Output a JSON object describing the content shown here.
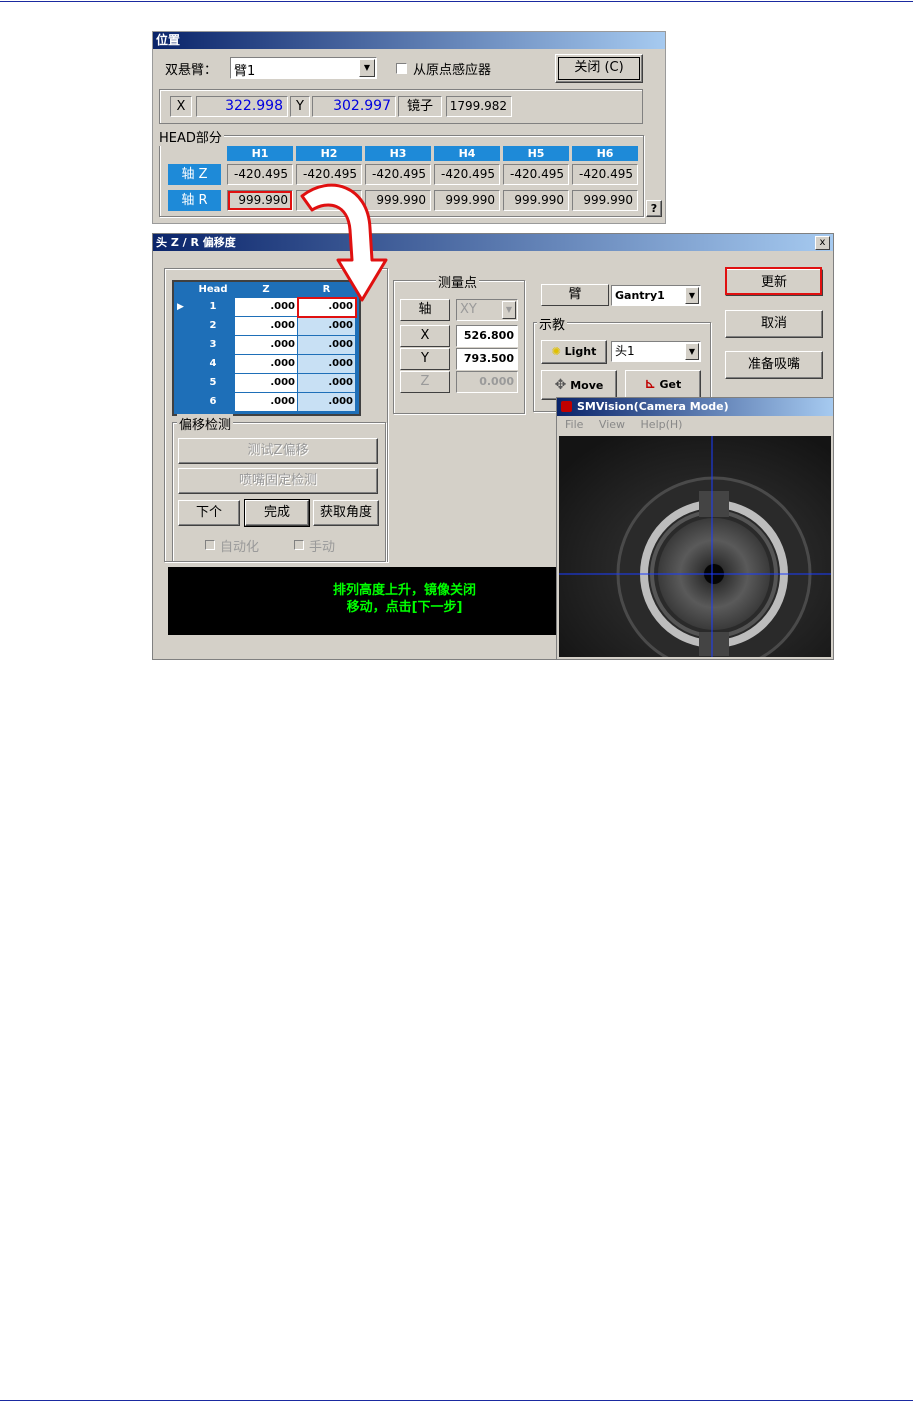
{
  "position_window": {
    "title": "位置",
    "gantry_label": "双悬臂：",
    "gantry_value": "臂1",
    "origin_sensor_label": "从原点感应器",
    "close_label": "关闭 (C)",
    "x_label": "X",
    "x_value": "322.998",
    "y_label": "Y",
    "y_value": "302.997",
    "mirror_label": "镜子",
    "mirror_value": "1799.982",
    "head_group_label": "HEAD部分",
    "heads": [
      "H1",
      "H2",
      "H3",
      "H4",
      "H5",
      "H6"
    ],
    "axis_z_label": "轴 Z",
    "axis_r_label": "轴 R",
    "z_values": [
      "-420.495",
      "-420.495",
      "-420.495",
      "-420.495",
      "-420.495",
      "-420.495"
    ],
    "r_values": [
      "999.990",
      "999.990",
      "999.990",
      "999.990",
      "999.990",
      "999.990"
    ],
    "help_label": "?"
  },
  "offset_dialog": {
    "title": "头 Z / R 偏移度",
    "close_label": "x",
    "table": {
      "headers": [
        "Head",
        "Z",
        "R"
      ],
      "rows": [
        {
          "head": "1",
          "z": ".000",
          "r": ".000"
        },
        {
          "head": "2",
          "z": ".000",
          "r": ".000"
        },
        {
          "head": "3",
          "z": ".000",
          "r": ".000"
        },
        {
          "head": "4",
          "z": ".000",
          "r": ".000"
        },
        {
          "head": "5",
          "z": ".000",
          "r": ".000"
        },
        {
          "head": "6",
          "z": ".000",
          "r": ".000"
        }
      ]
    },
    "measure_group_label": "测量点",
    "axis_label": "轴",
    "axis_value": "XY",
    "x_label": "X",
    "x_value": "526.800",
    "y_label": "Y",
    "y_value": "793.500",
    "z_label": "Z",
    "z_value": "0.000",
    "arm_label": "臂",
    "arm_value": "Gantry1",
    "teach_group_label": "示教",
    "light_label": "Light",
    "head_select_value": "头1",
    "move_label": "Move",
    "get_label": "Get",
    "update_label": "更新",
    "cancel_label": "取消",
    "prepare_nozzle_label": "准备吸嘴",
    "offset_check_group_label": "偏移检测",
    "test_z_offset_label": "测试Z偏移",
    "nozzle_fixed_check_label": "喷嘴固定检测",
    "next_label": "下个",
    "finish_label": "完成",
    "get_angle_label": "获取角度",
    "auto_label": "自动化",
    "manual_label": "手动",
    "message": "排列高度上升，镜像关闭\n移动，点击[下一步]"
  },
  "vision_window": {
    "title": "SMVision(Camera Mode)",
    "menu": [
      "File",
      "View",
      "Help(H)"
    ]
  },
  "colors": {
    "header_blue": "#1e8ad8",
    "highlight_red": "#e01010",
    "message_green": "#00ff00"
  }
}
